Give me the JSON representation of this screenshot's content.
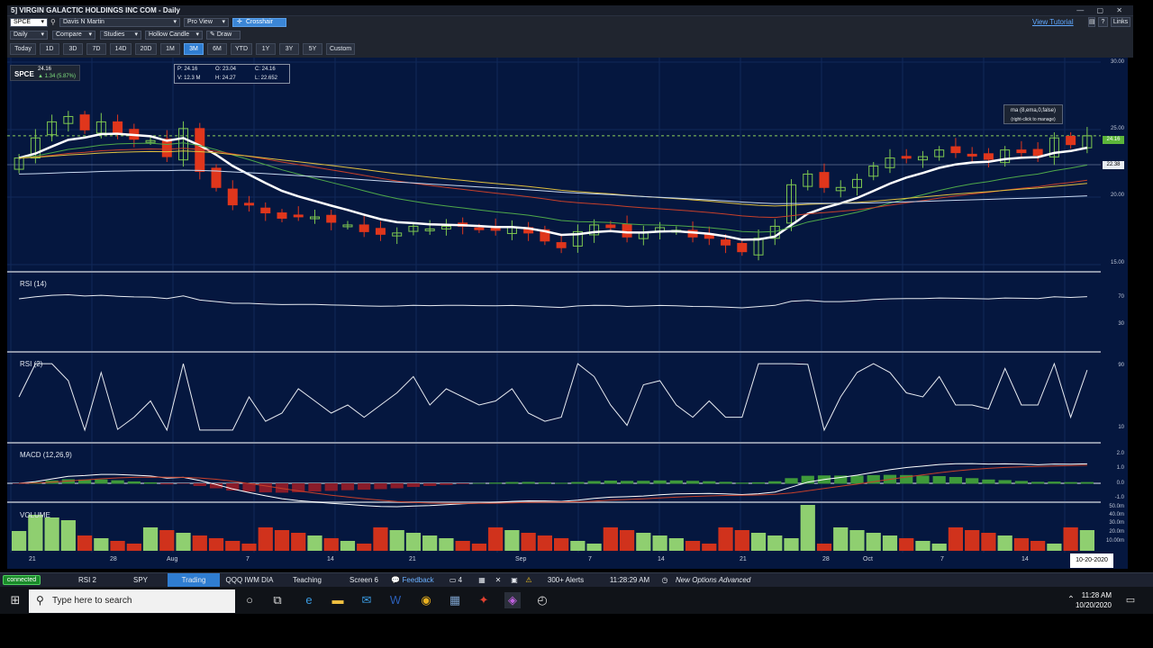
{
  "window": {
    "title": "5] VIRGIN GALACTIC HOLDINGS INC COM - Daily",
    "controls": "— ▢ ✕"
  },
  "toolbar1": {
    "symbol": "SPCE",
    "account": "Davis N Martin",
    "view": "Pro View",
    "crosshair": "Crosshair",
    "view_tutorial": "View Tutorial",
    "help": "?",
    "links": "Links"
  },
  "toolbar2": {
    "interval": "Daily",
    "compare": "Compare",
    "studies": "Studies",
    "candle": "Hollow Candle",
    "draw": "Draw"
  },
  "ranges": [
    "Today",
    "1D",
    "3D",
    "7D",
    "14D",
    "20D",
    "1M",
    "3M",
    "6M",
    "YTD",
    "1Y",
    "3Y",
    "5Y",
    "Custom"
  ],
  "active_range": "3M",
  "quote": {
    "symbol": "SPCE",
    "last": "24.16",
    "change": "▲ 1.34 (5.87%)"
  },
  "ohlc": {
    "p": "P: 24.16",
    "o": "O: 23.04",
    "c": "C: 24.16",
    "v": "V: 12.3 M",
    "h": "H: 24.27",
    "l": "L: 22.652"
  },
  "ma_tooltip": {
    "line1": "ma (8,ema,0,false)",
    "line2": "(right-click to manage)"
  },
  "price_axis": [
    "30.00",
    "25.00",
    "20.00",
    "15.00"
  ],
  "price_badges": {
    "last": "24.16",
    "ma": "22.38"
  },
  "panels": {
    "rsi14": {
      "label": "RSI (14)",
      "ticks": [
        "70",
        "30"
      ]
    },
    "rsi2": {
      "label": "RSI (2)",
      "ticks": [
        "90",
        "10"
      ]
    },
    "macd": {
      "label": "MACD (12,26,9)",
      "ticks": [
        "2.0",
        "1.0",
        "0.0",
        "-1.0"
      ]
    },
    "volume": {
      "label": "VOLUME",
      "ticks": [
        "50.0m",
        "40.0m",
        "30.0m",
        "20.0m",
        "10.00m"
      ]
    }
  },
  "x_axis": [
    "21",
    "28",
    "Aug",
    "7",
    "14",
    "21",
    "Sep",
    "7",
    "14",
    "21",
    "28",
    "Oct",
    "7",
    "14"
  ],
  "x_current_date": "10-20-2020",
  "statusbar": {
    "connected": "connected",
    "tabs": [
      "RSI 2",
      "SPY",
      "Trading",
      "QQQ IWM DIA",
      "Teaching",
      "Screen 6"
    ],
    "active_tab": "Trading",
    "feedback": "Feedback",
    "window_count": "4",
    "alerts": "300+ Alerts",
    "time": "11:28:29 AM EDT",
    "news": "New Options Advanced"
  },
  "taskbar": {
    "search_placeholder": "Type here to search",
    "clock_time": "11:28 AM",
    "clock_date": "10/20/2020"
  },
  "colors": {
    "chart_bg": "#05173f",
    "up": "#7ec850",
    "down": "#e0361c",
    "ma_white": "#ffffff",
    "accent_blue": "#2f7dd1"
  },
  "chart_data": {
    "type": "line",
    "title": "",
    "xlabel": "",
    "ylabel": "",
    "ylim": [
      14,
      30
    ],
    "series": [
      {
        "values": [
          22.5,
          24.0,
          25.2,
          25.6,
          24.6,
          25.2,
          24.4,
          23.9,
          23.8,
          22.6,
          24.7,
          21.5,
          20.3,
          19.0,
          19.0,
          18.4,
          18.0,
          18.2,
          18.1,
          17.7,
          17.5,
          17.0,
          16.8,
          16.9,
          17.4,
          17.2,
          17.4,
          17.4,
          17.2,
          17.1,
          17.3,
          16.9,
          16.3,
          15.8,
          17.0,
          17.5,
          17.3,
          16.6,
          16.9,
          17.3,
          17.1,
          16.6,
          16.5,
          16.0,
          15.5,
          16.5,
          17.4,
          20.5,
          21.3,
          20.3,
          20.3,
          20.9,
          21.9,
          22.5,
          22.6,
          22.6,
          23.1,
          22.9,
          22.7,
          22.4,
          23.1,
          22.9,
          22.7,
          24.0,
          23.5,
          24.16
        ]
      }
    ]
  }
}
